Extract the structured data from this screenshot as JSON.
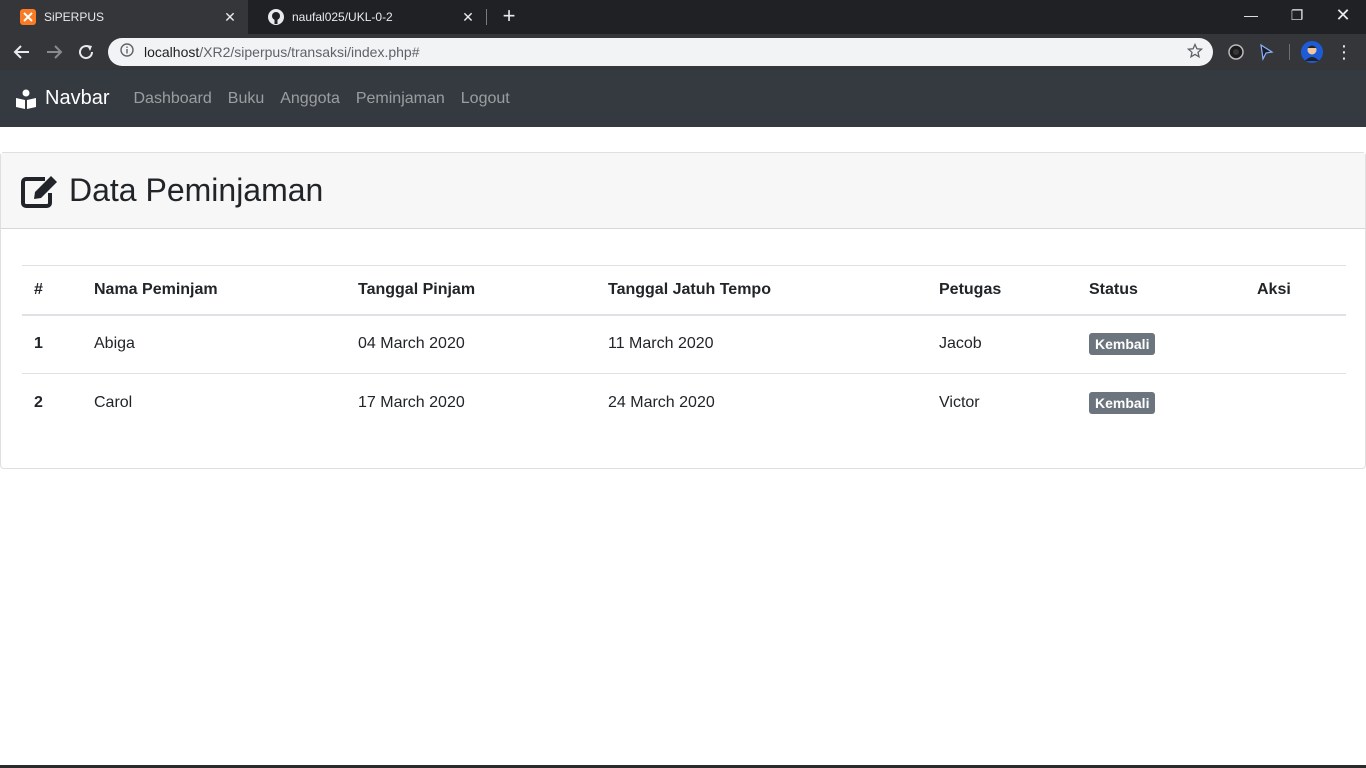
{
  "browser": {
    "tabs": [
      {
        "title": "SiPERPUS",
        "active": true
      },
      {
        "title": "naufal025/UKL-0-2",
        "active": false
      }
    ],
    "url_host": "localhost",
    "url_path": "/XR2/siperpus/transaksi/index.php#",
    "icons": [
      "back-icon",
      "forward-icon",
      "reload-icon",
      "info-icon",
      "star-icon",
      "extension-icon",
      "cursor-extension-icon",
      "profile-avatar",
      "menu-kebab-icon"
    ]
  },
  "navbar": {
    "brand": "Navbar",
    "links": [
      "Dashboard",
      "Buku",
      "Anggota",
      "Peminjaman",
      "Logout"
    ]
  },
  "card": {
    "title": "Data Peminjaman"
  },
  "table": {
    "headers": [
      "#",
      "Nama Peminjam",
      "Tanggal Pinjam",
      "Tanggal Jatuh Tempo",
      "Petugas",
      "Status",
      "Aksi"
    ],
    "rows": [
      {
        "no": "1",
        "nama": "Abiga",
        "pinjam": "04 March 2020",
        "tempo": "11 March 2020",
        "petugas": "Jacob",
        "status": "Kembali",
        "aksi": ""
      },
      {
        "no": "2",
        "nama": "Carol",
        "pinjam": "17 March 2020",
        "tempo": "24 March 2020",
        "petugas": "Victor",
        "status": "Kembali",
        "aksi": ""
      }
    ]
  },
  "colors": {
    "navbar_bg": "#343a40",
    "badge_bg": "#6c757d",
    "chrome_bg": "#202124"
  }
}
